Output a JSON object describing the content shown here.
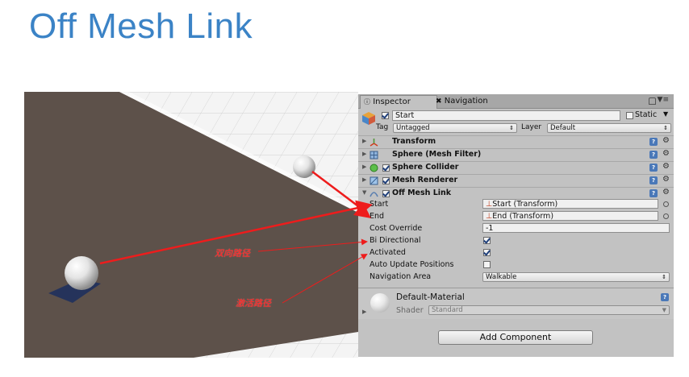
{
  "slide": {
    "title": "Off Mesh Link"
  },
  "colors": {
    "title": "#3b83c6",
    "arrow": "#ee1c1c",
    "road": "#5d514a",
    "panel": "#c2c2c2"
  },
  "inspector": {
    "tabs": {
      "inspector": "Inspector",
      "navigation": "Navigation"
    },
    "object": {
      "name": "Start",
      "active": true,
      "static_label": "Static",
      "static": false
    },
    "tag": {
      "label": "Tag",
      "value": "Untagged"
    },
    "layer": {
      "label": "Layer",
      "value": "Default"
    },
    "components": {
      "transform": "Transform",
      "mesh_filter": "Sphere (Mesh Filter)",
      "sphere_collider": "Sphere Collider",
      "mesh_renderer": "Mesh Renderer",
      "off_mesh_link": "Off Mesh Link"
    },
    "properties": {
      "start_label": "Start",
      "start_value": "Start (Transform)",
      "end_label": "End",
      "end_value": "End (Transform)",
      "cost_override_label": "Cost Override",
      "cost_override_value": "-1",
      "bi_directional_label": "Bi Directional",
      "bi_directional": true,
      "activated_label": "Activated",
      "activated": true,
      "auto_update_label": "Auto Update Positions",
      "auto_update": false,
      "nav_area_label": "Navigation Area",
      "nav_area_value": "Walkable"
    },
    "material": {
      "name": "Default-Material",
      "shader_label": "Shader",
      "shader_value": "Standard"
    },
    "add_component": "Add Component"
  },
  "annotations": {
    "bidirectional": "双向路径",
    "activate": "激活路径"
  },
  "icons": [
    "lock-icon",
    "menu-icon",
    "gameobject-icon",
    "transform-icon",
    "mesh-filter-icon",
    "sphere-collider-icon",
    "mesh-renderer-icon",
    "off-mesh-link-icon",
    "help-icon",
    "gear-icon",
    "target-icon",
    "sphere-icon"
  ]
}
